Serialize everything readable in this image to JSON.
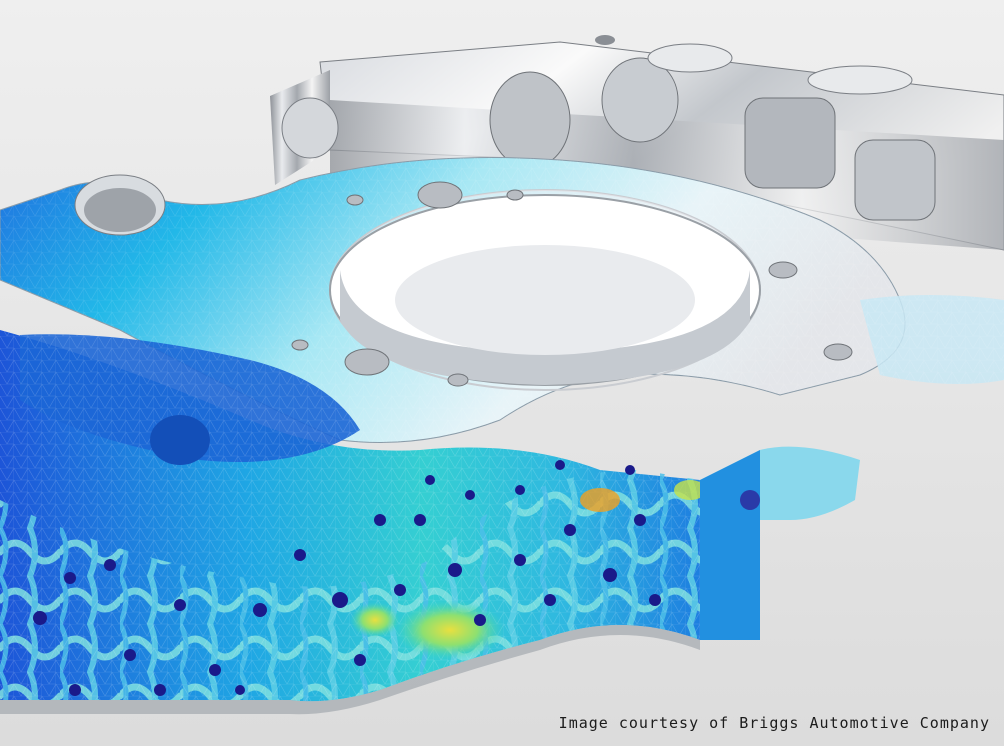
{
  "image": {
    "credit": "Image courtesy of Briggs Automotive Company"
  },
  "icons": {
    "part": "machined-bracket-render",
    "lattice": "lattice-infill",
    "mesh": "fea-mesh-overlay"
  },
  "colors": {
    "background": "#e8e8e8",
    "metal_light": "#f6f6f6",
    "metal_mid": "#c9cdd2",
    "metal_dark": "#7a7e84",
    "stress_low": "#1f4fd8",
    "stress_mid_low": "#1fb2e6",
    "stress_mid": "#3ad6c0",
    "stress_high": "#c7e34a",
    "stress_peak": "#f0a020",
    "node_dark": "#1a1a8a"
  }
}
